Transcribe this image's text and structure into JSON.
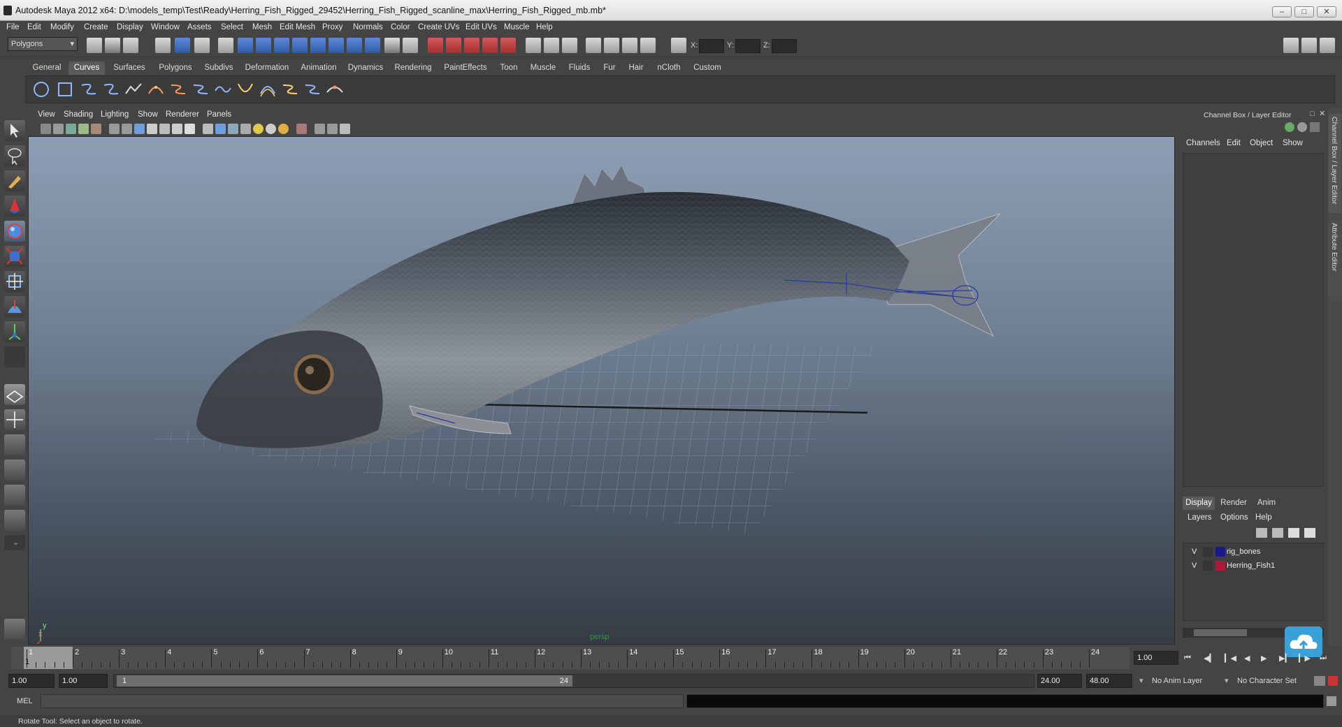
{
  "window": {
    "title": "Autodesk Maya 2012 x64: D:\\models_temp\\Test\\Ready\\Herring_Fish_Rigged_29452\\Herring_Fish_Rigged_scanline_max\\Herring_Fish_Rigged_mb.mb*"
  },
  "menubar": [
    "File",
    "Edit",
    "Modify",
    "Create",
    "Display",
    "Window",
    "Assets",
    "Select",
    "Mesh",
    "Edit Mesh",
    "Proxy",
    "Normals",
    "Color",
    "Create UVs",
    "Edit UVs",
    "Muscle",
    "Help"
  ],
  "status": {
    "mode": "Polygons",
    "x_label": "X:",
    "y_label": "Y:",
    "z_label": "Z:"
  },
  "shelf_tabs": [
    "General",
    "Curves",
    "Surfaces",
    "Polygons",
    "Subdivs",
    "Deformation",
    "Animation",
    "Dynamics",
    "Rendering",
    "PaintEffects",
    "Toon",
    "Muscle",
    "Fluids",
    "Fur",
    "Hair",
    "nCloth",
    "Custom"
  ],
  "shelf_active": "Curves",
  "viewport": {
    "menu": [
      "View",
      "Shading",
      "Lighting",
      "Show",
      "Renderer",
      "Panels"
    ],
    "camera_label": "persp",
    "axis_y": "y",
    "axis_x": "x"
  },
  "channel_box": {
    "title": "Channel Box / Layer Editor",
    "menu": [
      "Channels",
      "Edit",
      "Object",
      "Show"
    ],
    "layer_tabs": [
      "Display",
      "Render",
      "Anim"
    ],
    "layer_menu": [
      "Layers",
      "Options",
      "Help"
    ],
    "layers": [
      {
        "vis": "V",
        "name": "rig_bones",
        "color": "#1a1a8c"
      },
      {
        "vis": "V",
        "name": "Herring_Fish1",
        "color": "#b01a3a"
      }
    ]
  },
  "side_tabs": {
    "channel": "Channel Box / Layer Editor",
    "attr": "Attribute Editor"
  },
  "timeline": {
    "ticks": [
      "1",
      "2",
      "3",
      "4",
      "5",
      "6",
      "7",
      "8",
      "9",
      "10",
      "11",
      "12",
      "13",
      "14",
      "15",
      "16",
      "17",
      "18",
      "19",
      "20",
      "21",
      "22",
      "23",
      "24"
    ],
    "current_frame": "1",
    "current_frame_field": "1.00"
  },
  "range": {
    "start": "1.00",
    "start2": "1.00",
    "slider_start": "1",
    "slider_end": "24",
    "end": "24.00",
    "end2": "48.00",
    "anim_layer": "No Anim Layer",
    "char_set": "No Character Set"
  },
  "cmd": {
    "label": "MEL"
  },
  "help_line": "Rotate Tool: Select an object to rotate.",
  "colors": {
    "bg": "#444444",
    "accent": "#5a5a5a"
  }
}
